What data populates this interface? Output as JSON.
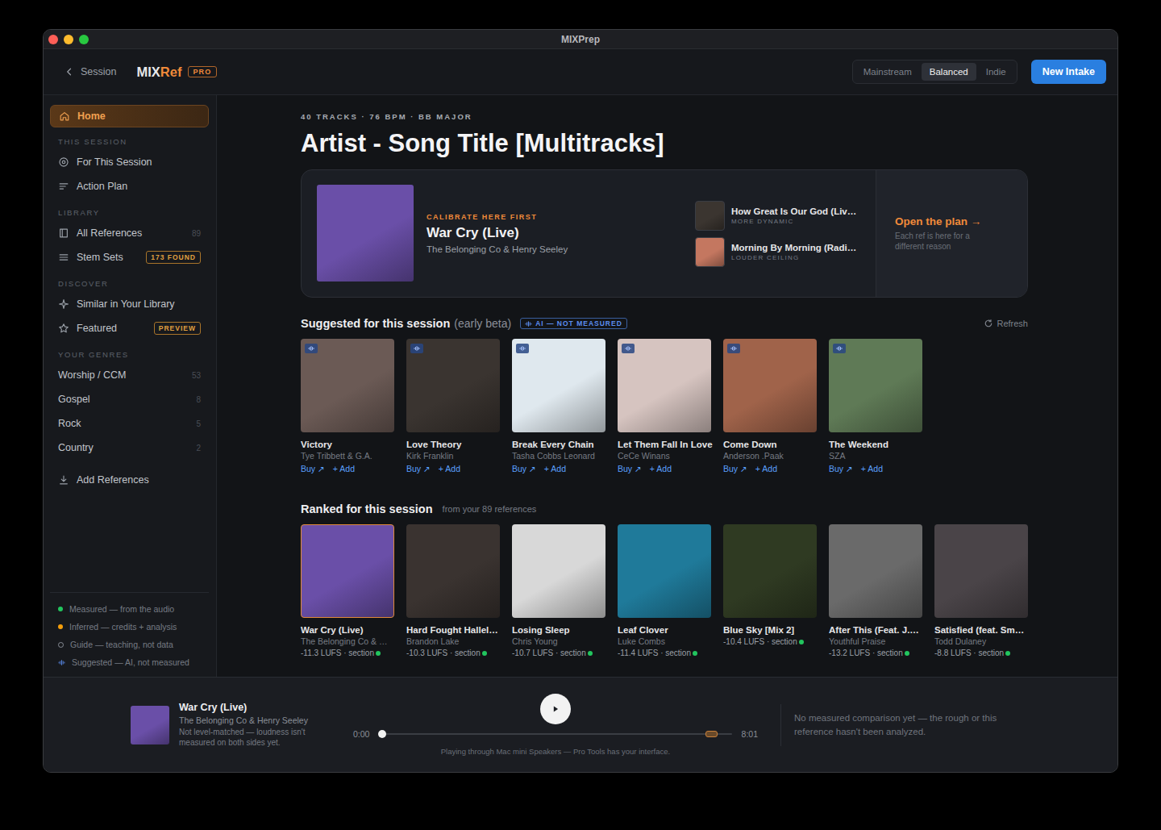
{
  "window": {
    "title": "MIXPrep"
  },
  "topbar": {
    "back": "Session",
    "logo_main": "MIX",
    "logo_accent": "Ref",
    "logo_badge": "PRO",
    "modes": [
      {
        "label": "Mainstream",
        "selected": false
      },
      {
        "label": "Balanced",
        "selected": true
      },
      {
        "label": "Indie",
        "selected": false
      }
    ],
    "primary_button": "New Intake"
  },
  "sidebar": {
    "home": {
      "label": "Home",
      "selected": true
    },
    "sections": [
      {
        "title": "THIS SESSION",
        "items": [
          {
            "label": "For This Session"
          },
          {
            "label": "Action Plan"
          }
        ]
      },
      {
        "title": "LIBRARY",
        "items": [
          {
            "label": "All References",
            "count": "89"
          },
          {
            "label": "Stem Sets",
            "badge": "173 FOUND"
          }
        ]
      },
      {
        "title": "DISCOVER",
        "items": [
          {
            "label": "Similar in Your Library"
          },
          {
            "label": "Featured",
            "badge": "PREVIEW"
          }
        ]
      },
      {
        "title": "YOUR GENRES",
        "items": [
          {
            "label": "Worship / CCM",
            "count": "53"
          },
          {
            "label": "Gospel",
            "count": "8"
          },
          {
            "label": "Rock",
            "count": "5"
          },
          {
            "label": "Country",
            "count": "2"
          }
        ]
      }
    ],
    "action": "Add References",
    "legend": [
      {
        "label": "Measured — from the audio",
        "kind": "dot",
        "color": "#22c55e"
      },
      {
        "label": "Inferred — credits + analysis",
        "kind": "dot",
        "color": "#f59e0b"
      },
      {
        "label": "Guide — teaching, not data",
        "kind": "ring",
        "color": "#8a8f98"
      },
      {
        "label": "Suggested — AI, not measured",
        "kind": "wave",
        "color": "#5b8def"
      }
    ]
  },
  "session": {
    "meta": "40 TRACKS · 76 BPM · BB MAJOR",
    "title": "Artist - Song Title [Multitracks]"
  },
  "hero": {
    "label": "CALIBRATE HERE FIRST",
    "title": "War Cry (Live)",
    "artist": "The Belonging Co & Henry Seeley",
    "color": "#6a4fa8",
    "refs": [
      {
        "title": "How Great Is Our God (Liv…",
        "note": "MORE DYNAMIC",
        "color": "#3b3530"
      },
      {
        "title": "Morning By Morning (Radi…",
        "note": "LOUDER CEILING",
        "color": "#c47760"
      }
    ],
    "cta": {
      "label": "Open the plan →",
      "note": "Each ref is here for a different reason"
    }
  },
  "suggested": {
    "title": "Suggested for this session",
    "subtitle": "(early beta)",
    "badge": "AI — NOT MEASURED",
    "refresh": "Refresh",
    "buy_label": "Buy ↗",
    "add_label": "+ Add",
    "items": [
      {
        "title": "Victory",
        "artist": "Tye Tribbett & G.A.",
        "color": "#6b5a55"
      },
      {
        "title": "Love Theory",
        "artist": "Kirk Franklin",
        "color": "#3a3430"
      },
      {
        "title": "Break Every Chain",
        "artist": "Tasha Cobbs Leonard",
        "color": "#dfe8ee"
      },
      {
        "title": "Let Them Fall In Love",
        "artist": "CeCe Winans",
        "color": "#d6c4c0"
      },
      {
        "title": "Come Down",
        "artist": "Anderson .Paak",
        "color": "#a0634a"
      },
      {
        "title": "The Weekend",
        "artist": "SZA",
        "color": "#5f7a56"
      }
    ]
  },
  "ranked": {
    "title": "Ranked for this session",
    "subtitle": "from your 89 references",
    "items": [
      {
        "title": "War Cry (Live)",
        "artist": "The Belonging Co & …",
        "stats": "-11.3 LUFS · section",
        "dot_color": "#22c55e",
        "selected": true,
        "color": "#6a4fa8"
      },
      {
        "title": "Hard Fought Hallel…",
        "artist": "Brandon Lake",
        "stats": "-10.3 LUFS · section",
        "dot_color": "#22c55e",
        "selected": false,
        "color": "#3a3330"
      },
      {
        "title": "Losing Sleep",
        "artist": "Chris Young",
        "stats": "-10.7 LUFS · section",
        "dot_color": "#22c55e",
        "selected": false,
        "color": "#d8d8d8"
      },
      {
        "title": "Leaf Clover",
        "artist": "Luke Combs",
        "stats": "-11.4 LUFS · section",
        "dot_color": "#22c55e",
        "selected": false,
        "color": "#1f7a9a"
      },
      {
        "title": "Blue Sky [Mix 2]",
        "artist": "",
        "stats": "-10.4 LUFS · section",
        "dot_color": "#22c55e",
        "selected": false,
        "color": "#2f3a22"
      },
      {
        "title": "After This (Feat. J.…",
        "artist": "Youthful Praise",
        "stats": "-13.2 LUFS · section",
        "dot_color": "#22c55e",
        "selected": false,
        "color": "#6a6a6a"
      },
      {
        "title": "Satisfied (feat. Sm…",
        "artist": "Todd Dulaney",
        "stats": "-8.8 LUFS · section",
        "dot_color": "#22c55e",
        "selected": false,
        "color": "#4a4448"
      }
    ]
  },
  "player": {
    "title": "War Cry (Live)",
    "artist": "The Belonging Co & Henry Seeley",
    "note": "Not level-matched — loudness isn't measured on both sides yet.",
    "color": "#6a4fa8",
    "playing": false,
    "elapsed": "0:00",
    "duration": "8:01",
    "level": 0,
    "marker": 0.94,
    "output": "Playing through Mac mini Speakers — Pro Tools has your interface.",
    "message": "No measured comparison yet — the rough or this reference hasn't been analyzed."
  }
}
